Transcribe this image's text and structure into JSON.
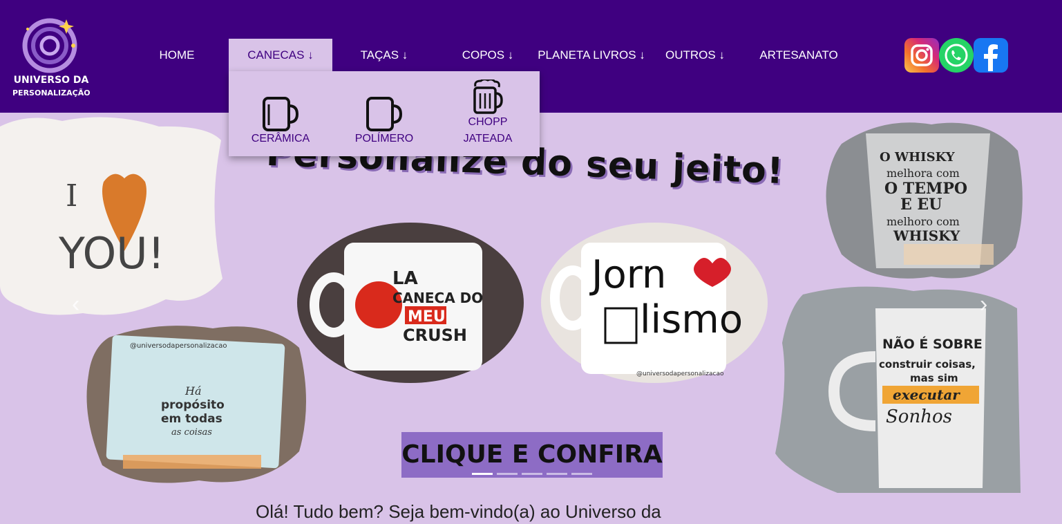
{
  "brand": {
    "line1": "UNIVERSO DA",
    "line2": "PERSONALIZAÇÃO"
  },
  "nav": {
    "home": "HOME",
    "canecas": "CANECAS ↓",
    "tacas": "TAÇAS ↓",
    "copos": "COPOS ↓",
    "planeta_livros": "PLANETA LIVROS ↓",
    "outros": "OUTROS ↓",
    "artesanato": "ARTESANATO"
  },
  "dropdown": {
    "ceramica": "CERÂMICA",
    "polimero": "POLÍMERO",
    "chopp_line1": "CHOPP",
    "chopp_line2": "JATEADA"
  },
  "social": [
    "instagram-icon",
    "whatsapp-icon",
    "facebook-icon"
  ],
  "hero": {
    "headline": "Personalize do seu jeito!",
    "cta": "CLIQUE E CONFIRA",
    "prev_arrow": "‹",
    "next_arrow": "›",
    "slide_count": 5,
    "active_slide": 1,
    "images": {
      "shirt_text_1": "I",
      "shirt_text_2": "YOU!",
      "mug1_line1": "LA",
      "mug1_line2": "CANECA DO",
      "mug1_line3": "MEU",
      "mug1_line4": "CRUSH",
      "mug2_line1": "Jorn",
      "mug2_line2": "lismo",
      "mug2_handle": "@universodapersonalizacao",
      "whisky_line1": "O WHISKY",
      "whisky_line2": "melhora com",
      "whisky_line3": "O TEMPO",
      "whisky_line4": "E EU",
      "whisky_line5": "melhoro com",
      "whisky_line6": "WHISKY",
      "frame_handle": "@universodapersonalizacao",
      "frame_line1": "Há",
      "frame_line2": "propósito",
      "frame_line3": "em todas",
      "frame_line4": "as coisas",
      "chopp_line1": "NÃO É SOBRE",
      "chopp_line2": "construir coisas,",
      "chopp_line3": "mas sim",
      "chopp_line4": "executar",
      "chopp_line5": "Sonhos"
    }
  },
  "welcome": "Olá! Tudo bem? Seja bem-vindo(a) ao Universo da",
  "colors": {
    "header": "#3f0080",
    "hero_bg": "#d9c3e8",
    "cta_bg": "#8d6cc5",
    "dropdown_text": "#3f0080"
  }
}
